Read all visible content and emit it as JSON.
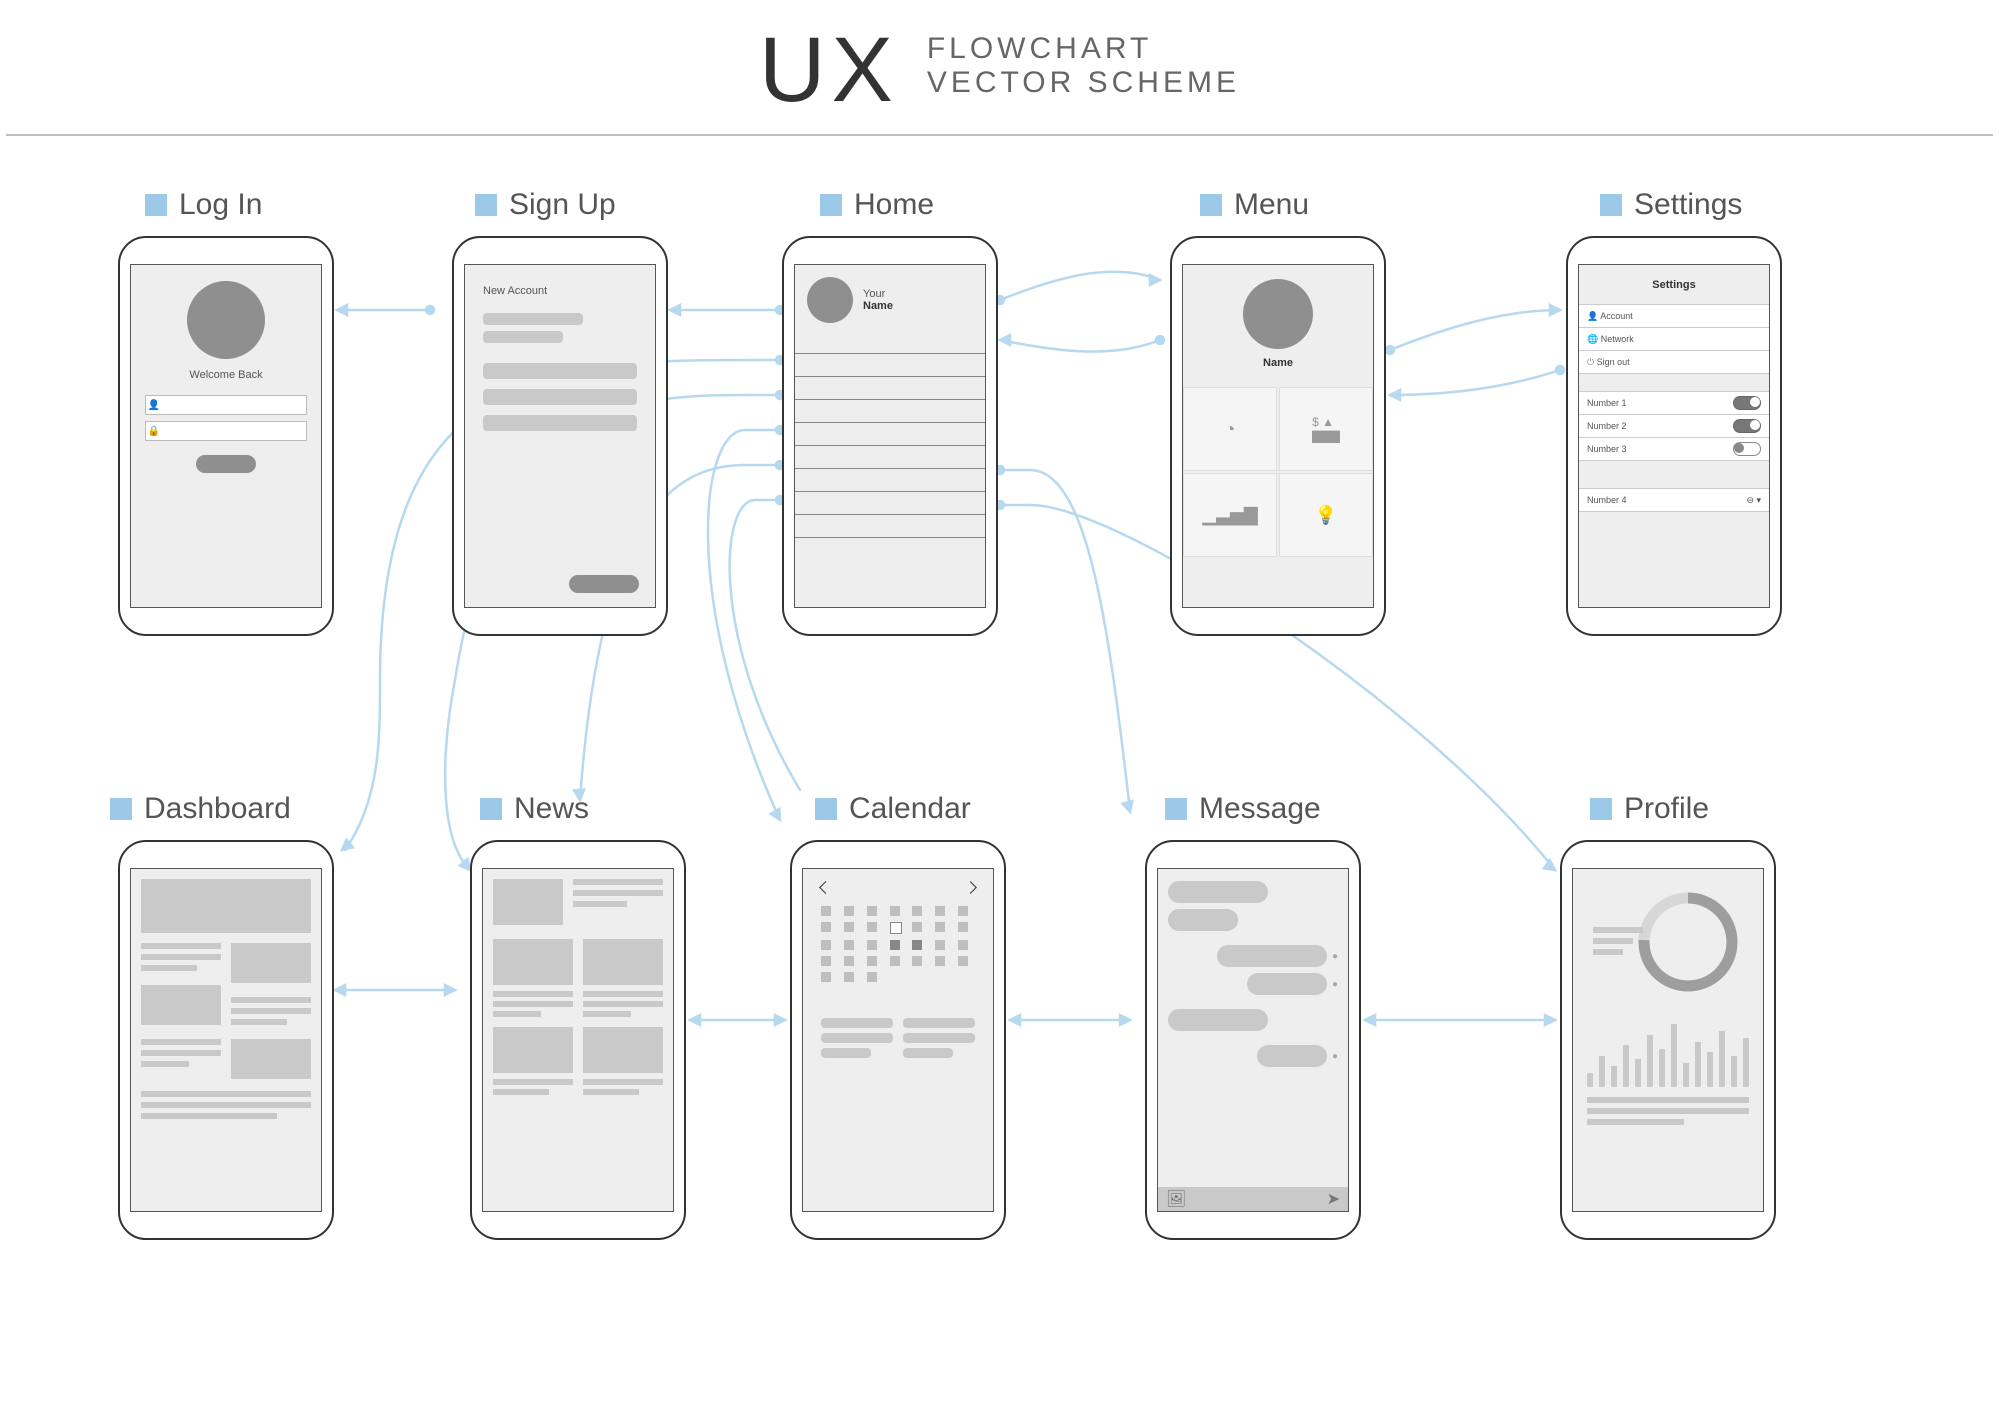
{
  "header": {
    "brand": "UX",
    "line1": "FLOWCHART",
    "line2": "VECTOR SCHEME"
  },
  "screens": {
    "login": {
      "label": "Log In",
      "welcome": "Welcome Back"
    },
    "signup": {
      "label": "Sign Up",
      "heading": "New Account"
    },
    "home": {
      "label": "Home",
      "your": "Your",
      "name": "Name"
    },
    "menu": {
      "label": "Menu",
      "name": "Name"
    },
    "settings": {
      "label": "Settings",
      "heading": "Settings",
      "links": [
        {
          "icon": "user",
          "label": "Account"
        },
        {
          "icon": "globe",
          "label": "Network"
        },
        {
          "icon": "power",
          "label": "Sign out"
        }
      ],
      "toggles": [
        {
          "label": "Number 1",
          "on": true
        },
        {
          "label": "Number 2",
          "on": true
        },
        {
          "label": "Number 3",
          "on": false
        }
      ],
      "extra": {
        "label": "Number 4"
      }
    },
    "dashboard": {
      "label": "Dashboard"
    },
    "news": {
      "label": "News"
    },
    "calendar": {
      "label": "Calendar"
    },
    "message": {
      "label": "Message"
    },
    "profile": {
      "label": "Profile"
    }
  },
  "colors": {
    "accent": "#9dc9e8",
    "connector": "#b7d9ef",
    "wire_dark": "#8f8f8f",
    "wire_mid": "#c9c9c9",
    "wire_light": "#eeeeee"
  }
}
